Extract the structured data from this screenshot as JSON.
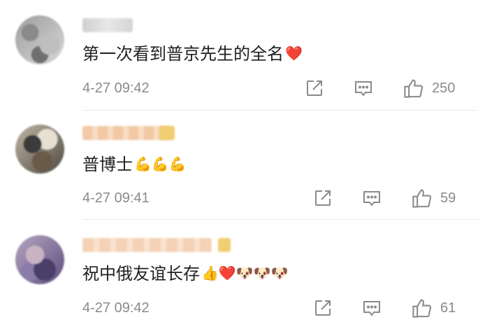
{
  "comments": [
    {
      "text": "第一次看到普京先生的全名",
      "emojis": "❤️",
      "time": "4-27 09:42",
      "likes": "250"
    },
    {
      "text": "普博士",
      "emojis": "💪💪💪",
      "time": "4-27 09:41",
      "likes": "59"
    },
    {
      "text": "祝中俄友谊长存",
      "emojis": "👍❤️🐶🐶🐶",
      "time": "4-27 09:42",
      "likes": "61"
    }
  ],
  "icons": {
    "share": "share-icon",
    "comment": "comment-icon",
    "like": "thumbs-up-icon"
  },
  "colors": {
    "text": "#1f1f1f",
    "meta": "#8a8a8a",
    "heart": "#e8232b"
  }
}
